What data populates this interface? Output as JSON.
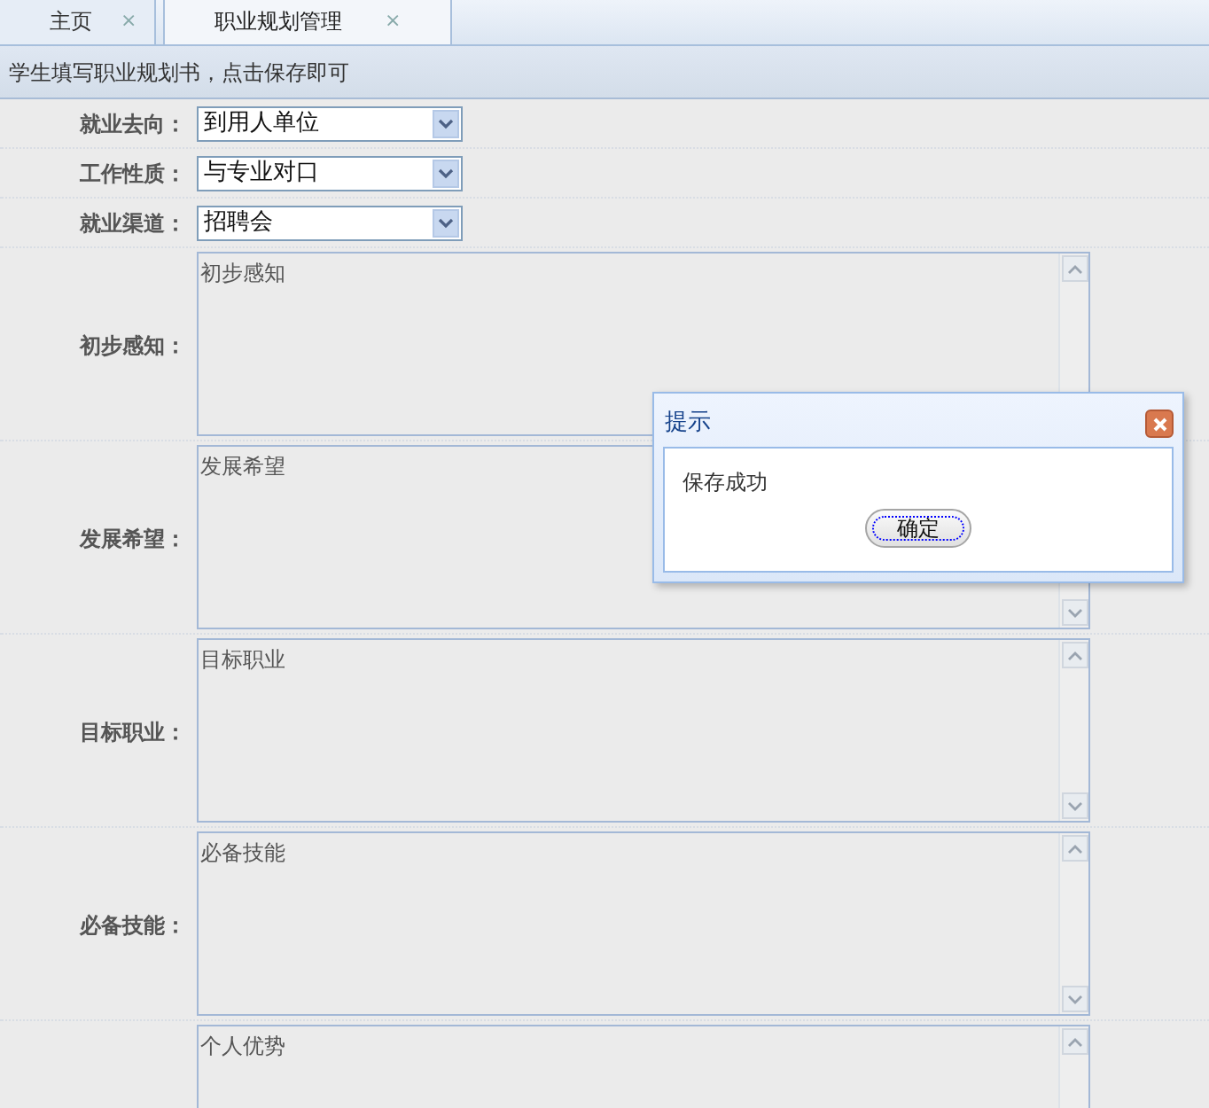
{
  "tabs": [
    {
      "label": "主页",
      "close": "×",
      "selected": false
    },
    {
      "label": "职业规划管理",
      "close": "×",
      "selected": true
    }
  ],
  "header": "学生填写职业规划书，点击保存即可",
  "selects": [
    {
      "label": "就业去向：",
      "value": "到用人单位"
    },
    {
      "label": "工作性质：",
      "value": "与专业对口"
    },
    {
      "label": "就业渠道：",
      "value": "招聘会"
    }
  ],
  "textareas": [
    {
      "label": "初步感知：",
      "value": "初步感知"
    },
    {
      "label": "发展希望：",
      "value": "发展希望"
    },
    {
      "label": "目标职业：",
      "value": "目标职业"
    },
    {
      "label": "必备技能：",
      "value": "必备技能"
    },
    {
      "value": "个人优势"
    }
  ],
  "dialog": {
    "title": "提示",
    "message": "保存成功",
    "button": "确定"
  }
}
